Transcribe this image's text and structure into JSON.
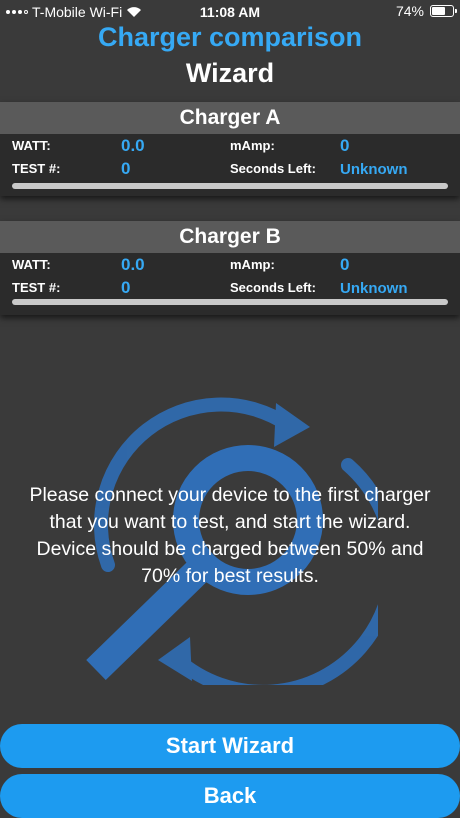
{
  "status_bar": {
    "carrier": "T-Mobile Wi-Fi",
    "time": "11:08 AM",
    "battery": "74%",
    "battery_level": 0.74
  },
  "header": {
    "title_line1": "Charger comparison",
    "title_line2": "Wizard"
  },
  "chargers": [
    {
      "title": "Charger A",
      "watt_label": "WATT:",
      "watt_value": "0.0",
      "mamp_label": "mAmp:",
      "mamp_value": "0",
      "test_label": "TEST #:",
      "test_value": "0",
      "seconds_label": "Seconds Left:",
      "seconds_value": "Unknown",
      "progress": 0
    },
    {
      "title": "Charger B",
      "watt_label": "WATT:",
      "watt_value": "0.0",
      "mamp_label": "mAmp:",
      "mamp_value": "0",
      "test_label": "TEST #:",
      "test_value": "0",
      "seconds_label": "Seconds Left:",
      "seconds_value": "Unknown",
      "progress": 0
    }
  ],
  "message": "Please connect your device to the first charger\nthat you want to test, and start the wizard.\nDevice should be charged between 50% and\n70% for best results.",
  "buttons": {
    "start": "Start Wizard",
    "back": "Back"
  },
  "colors": {
    "accent": "#36a9f4",
    "button": "#1d9bf0",
    "background": "#3a3a3a"
  },
  "icons": {
    "background": "magnifier-sync-icon",
    "wifi": "wifi-icon",
    "battery": "battery-icon"
  }
}
